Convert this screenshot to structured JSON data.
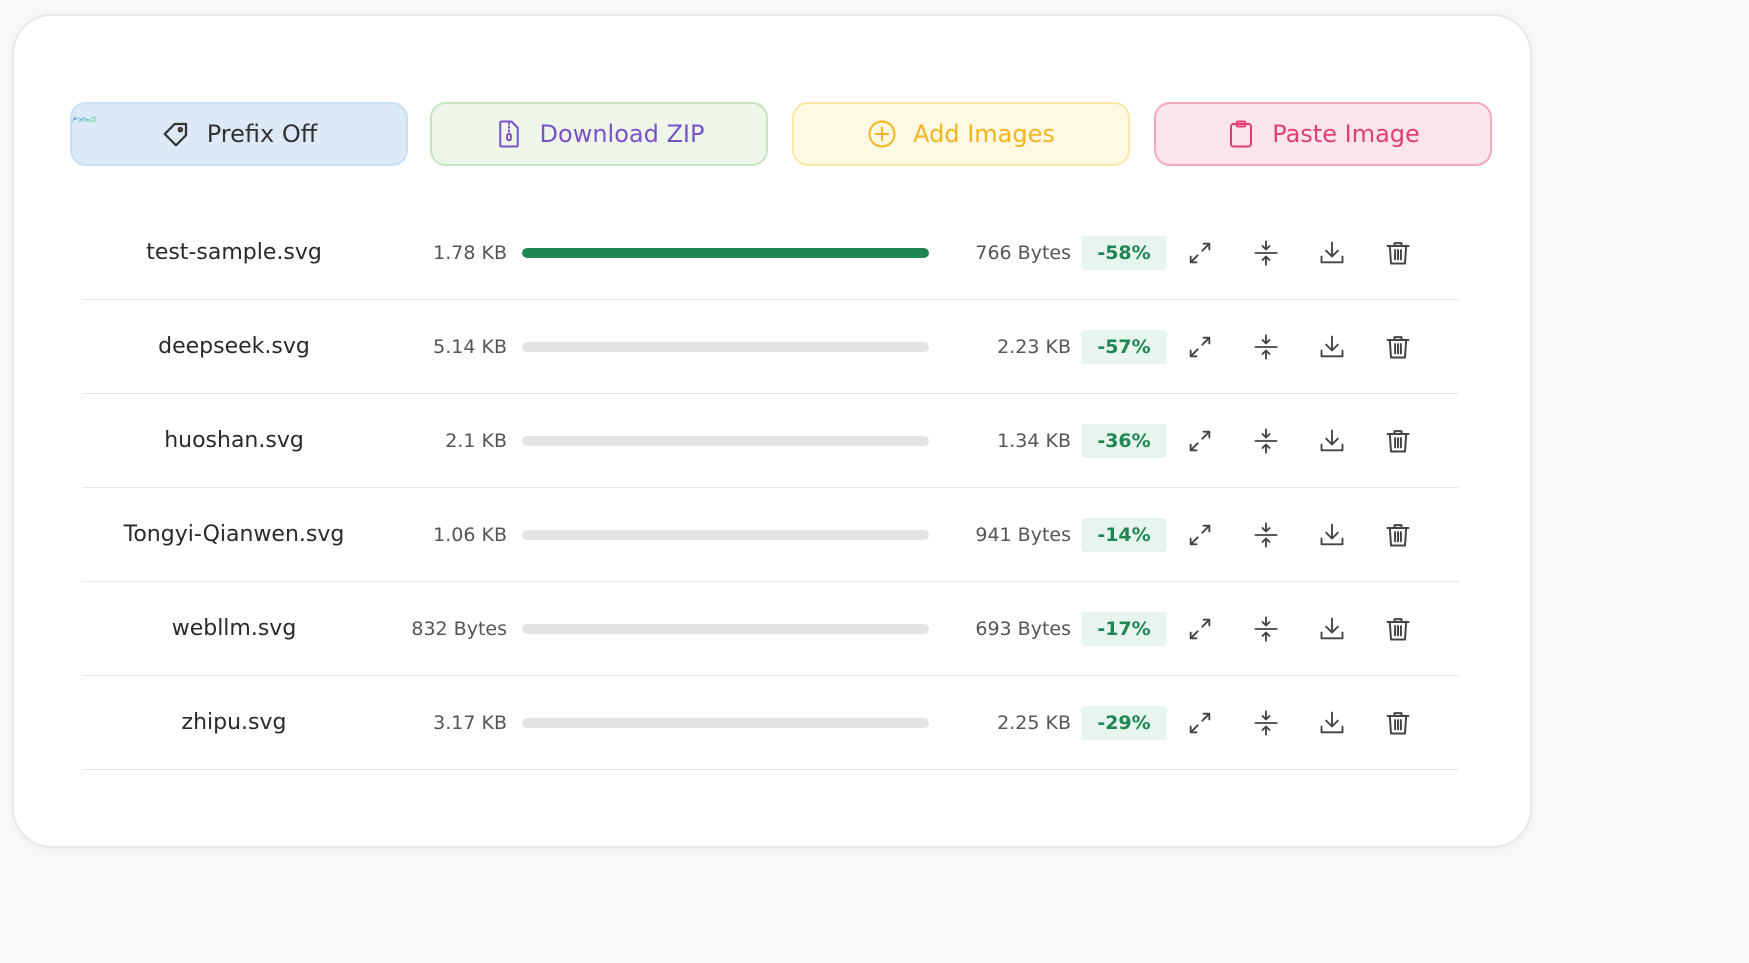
{
  "toolbar": {
    "prefix_label": "Prefix Off",
    "zip_label": "Download ZIP",
    "add_label": "Add Images",
    "paste_label": "Paste Image"
  },
  "files": [
    {
      "name": "test-sample.svg",
      "original": "1.78 KB",
      "compressed": "766 Bytes",
      "saving": "-58%",
      "progress": 1.0
    },
    {
      "name": "deepseek.svg",
      "original": "5.14 KB",
      "compressed": "2.23 KB",
      "saving": "-57%",
      "progress": 0.0
    },
    {
      "name": "huoshan.svg",
      "original": "2.1 KB",
      "compressed": "1.34 KB",
      "saving": "-36%",
      "progress": 0.0
    },
    {
      "name": "Tongyi-Qianwen.svg",
      "original": "1.06 KB",
      "compressed": "941 Bytes",
      "saving": "-14%",
      "progress": 0.0
    },
    {
      "name": "webllm.svg",
      "original": "832 Bytes",
      "compressed": "693 Bytes",
      "saving": "-17%",
      "progress": 0.0
    },
    {
      "name": "zhipu.svg",
      "original": "3.17 KB",
      "compressed": "2.25 KB",
      "saving": "-29%",
      "progress": 0.0
    }
  ],
  "icons": {
    "row_actions": [
      "expand-icon",
      "compress-icon",
      "download-icon",
      "trash-icon"
    ]
  },
  "colors": {
    "success": "#1f8654",
    "zip": "#7b52c9",
    "add": "#f2b51b",
    "paste": "#e23d77"
  }
}
